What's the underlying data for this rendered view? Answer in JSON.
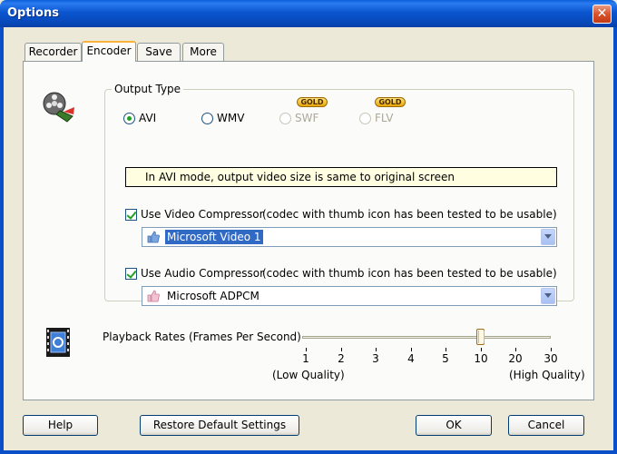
{
  "window": {
    "title": "Options",
    "close_glyph": "✕"
  },
  "tabs": [
    {
      "label": "Recorder",
      "active": false
    },
    {
      "label": "Encoder",
      "active": true
    },
    {
      "label": "Save",
      "active": false
    },
    {
      "label": "More",
      "active": false
    }
  ],
  "encoder": {
    "output_type_label": "Output Type",
    "formats": [
      {
        "label": "AVI",
        "selected": true,
        "enabled": true
      },
      {
        "label": "WMV",
        "selected": false,
        "enabled": true
      },
      {
        "label": "SWF",
        "selected": false,
        "enabled": false,
        "badge": "GOLD"
      },
      {
        "label": "FLV",
        "selected": false,
        "enabled": false,
        "badge": "GOLD"
      }
    ],
    "info_text": "In AVI mode, output video size is same to original screen",
    "video_compressor": {
      "label": "Use Video Compressor",
      "note": "(codec with thumb icon has been tested to be usable)",
      "checked": true,
      "selected": "Microsoft Video 1"
    },
    "audio_compressor": {
      "label": "Use Audio Compressor",
      "note": "(codec with thumb icon has been tested to be usable)",
      "checked": true,
      "selected": "Microsoft ADPCM"
    },
    "playback": {
      "label": "Playback Rates (Frames Per Second)",
      "ticks": [
        "1",
        "2",
        "3",
        "4",
        "5",
        "10",
        "20",
        "30"
      ],
      "selected_value": "10",
      "low_label": "(Low Quality)",
      "high_label": "(High Quality)"
    }
  },
  "buttons": {
    "help": "Help",
    "restore": "Restore Default Settings",
    "ok": "OK",
    "cancel": "Cancel"
  },
  "colors": {
    "titlebar": "#0a56d0",
    "accent_green": "#21a121",
    "info_bg": "#fffee1",
    "selection": "#316ac5"
  }
}
